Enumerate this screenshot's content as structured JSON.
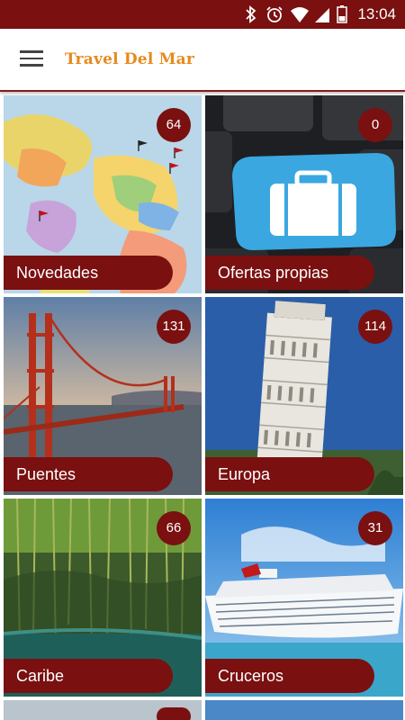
{
  "status_bar": {
    "time": "13:04",
    "icons": [
      "bluetooth-icon",
      "alarm-icon",
      "wifi-icon",
      "signal-icon",
      "battery-icon"
    ]
  },
  "app_bar": {
    "title": "Travel Del Mar",
    "menu_icon": "hamburger-menu-icon"
  },
  "colors": {
    "status_bar": "#7a1010",
    "accent": "#7a1010",
    "title": "#e8891c"
  },
  "categories": [
    {
      "label": "Novedades",
      "count": "64"
    },
    {
      "label": "Ofertas propias",
      "count": "0"
    },
    {
      "label": "Puentes",
      "count": "131"
    },
    {
      "label": "Europa",
      "count": "114"
    },
    {
      "label": "Caribe",
      "count": "66"
    },
    {
      "label": "Cruceros",
      "count": "31"
    }
  ]
}
